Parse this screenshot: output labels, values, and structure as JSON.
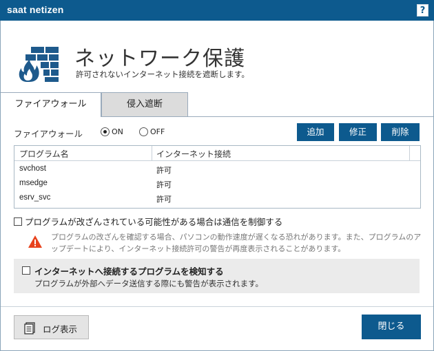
{
  "app": {
    "title": "saat netizen",
    "help_label": "?"
  },
  "header": {
    "title": "ネットワーク保護",
    "subtitle": "許可されないインターネット接続を遮断します。"
  },
  "tabs": [
    {
      "label": "ファイアウォール",
      "active": true
    },
    {
      "label": "侵入遮断",
      "active": false
    }
  ],
  "firewall": {
    "label": "ファイアウォール",
    "on_label": "ON",
    "off_label": "OFF",
    "selected": "ON"
  },
  "toolbar": {
    "add": "追加",
    "edit": "修正",
    "delete": "削除"
  },
  "table": {
    "columns": [
      "プログラム名",
      "インターネット接続"
    ],
    "rows": [
      {
        "program": "svchost",
        "access": "許可"
      },
      {
        "program": "msedge",
        "access": "許可"
      },
      {
        "program": "esrv_svc",
        "access": "許可"
      }
    ]
  },
  "control_option": {
    "label": "プログラムが改ざんされている可能性がある場合は通信を制御する",
    "checked": false
  },
  "warning": {
    "text": "プログラムの改ざんを確認する場合、パソコンの動作速度が遅くなる恐れがあります。また、プログラムのアップデートにより、インターネット接続許可の警告が再度表示されることがあります。"
  },
  "detect_option": {
    "title": "インターネットへ接続するプログラムを検知する",
    "description": "プログラムが外部へデータ送信する際にも警告が表示されます。",
    "checked": false
  },
  "footer": {
    "log_button": "ログ表示",
    "close_button": "閉じる"
  },
  "colors": {
    "brand": "#0d5a8e",
    "warning": "#e8431e",
    "shield": "#1e5a8c"
  }
}
